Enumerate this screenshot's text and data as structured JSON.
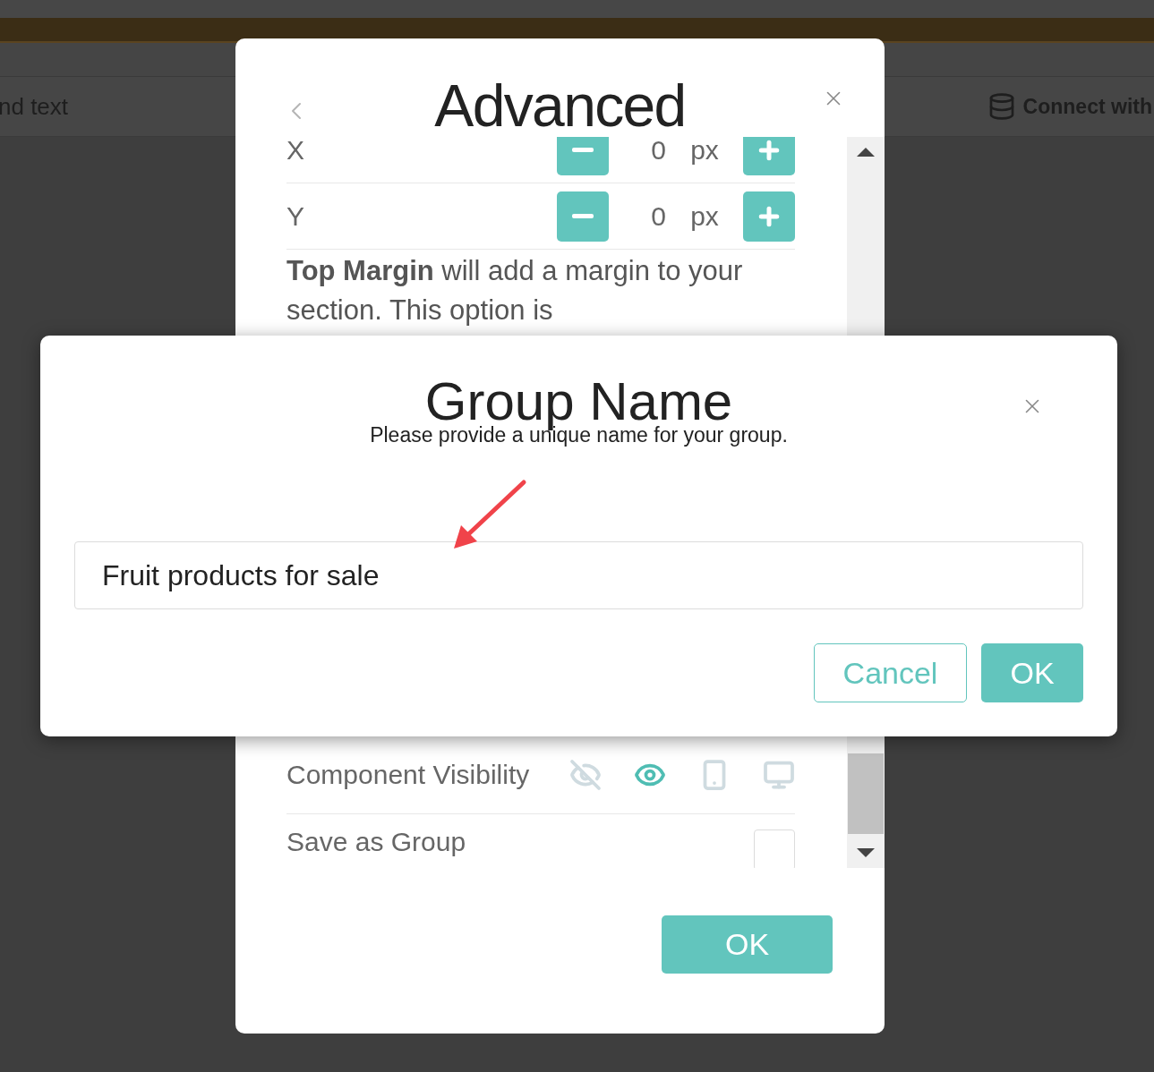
{
  "background": {
    "toolbar_left": "nd text",
    "toolbar_right": "Connect with"
  },
  "advanced_dialog": {
    "title": "Advanced",
    "position_rows": [
      {
        "label": "X",
        "value": "0",
        "unit": "px"
      },
      {
        "label": "Y",
        "value": "0",
        "unit": "px"
      }
    ],
    "note": "**Top Margin** will add a margin to your section. This option is",
    "visibility": {
      "label": "Component Visibility",
      "options": [
        {
          "kind": "hidden",
          "selected": false
        },
        {
          "kind": "visible",
          "selected": true
        },
        {
          "kind": "mobile",
          "selected": false
        },
        {
          "kind": "desktop",
          "selected": false
        }
      ]
    },
    "save_as_group": {
      "label": "Save as Group",
      "checked": false
    },
    "ok_button": "OK"
  },
  "group_name_dialog": {
    "title": "Group Name",
    "subtitle": "Please provide a unique name for your group.",
    "input_value": "Fruit products for sale",
    "buttons": [
      {
        "label": "Cancel",
        "kind": "secondary"
      },
      {
        "label": "OK",
        "kind": "primary"
      }
    ]
  }
}
